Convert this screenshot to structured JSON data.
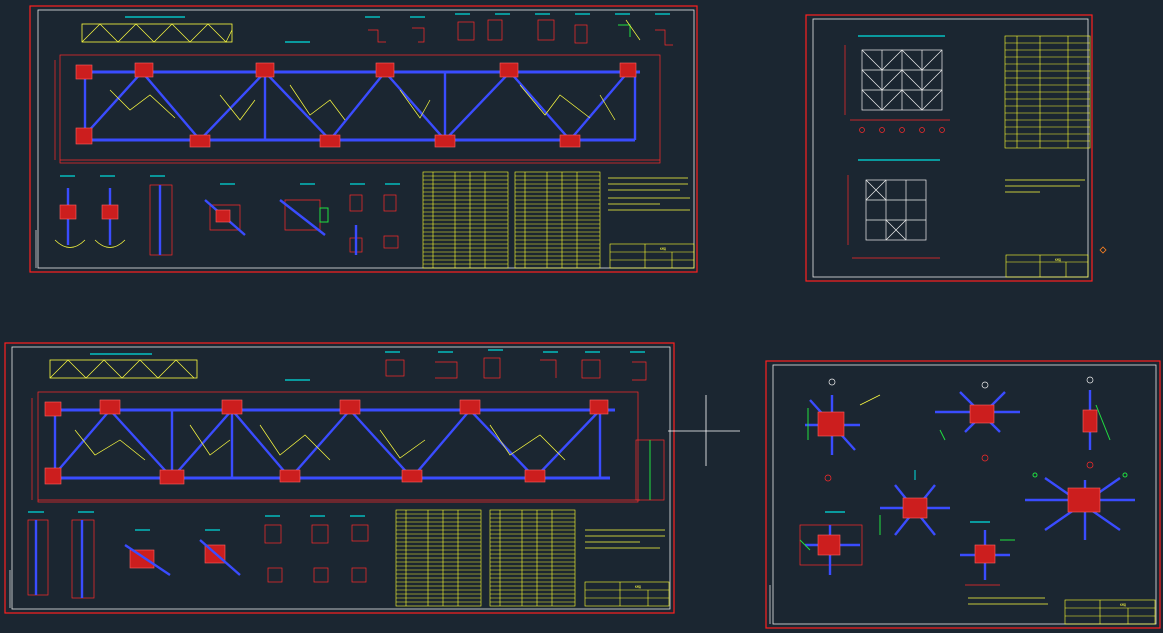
{
  "workspace": {
    "background": "#1b2631",
    "crosshair_cursor": true
  },
  "colors": {
    "sheet_border": "#ff2020",
    "members": "#3a4cff",
    "dimensions": "#ff2a2a",
    "leaders_text": "#ffff40",
    "titles": "#00e0e0",
    "steel_sections": "#20e040"
  },
  "sheets": [
    {
      "id": "truss-sheet-top",
      "kind": "truss elevation with details and specification"
    },
    {
      "id": "plan-sheet",
      "kind": "bracing plan with element schedule"
    },
    {
      "id": "truss-sheet-bottom",
      "kind": "truss elevation with details and specification"
    },
    {
      "id": "nodes-sheet",
      "kind": "node details"
    }
  ],
  "title_blocks": {
    "truss_sheet_top": {
      "sheet_code": "КМД"
    },
    "plan_sheet": {
      "sheet_code": "КМД"
    },
    "truss_sheet_bottom": {
      "sheet_code": "КМД"
    },
    "nodes_sheet": {
      "sheet_code": "КМД"
    }
  }
}
